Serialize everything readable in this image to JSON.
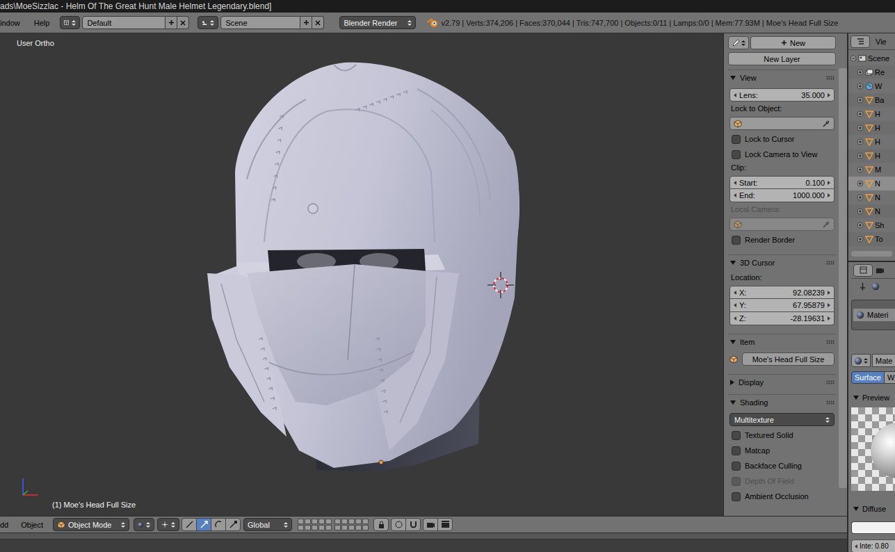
{
  "window": {
    "title": "ads\\MoeSizzlac - Helm Of The Great Hunt Male Helmet Legendary.blend]"
  },
  "info_header": {
    "menus": [
      "indow",
      "Help"
    ],
    "screen_layout": "Default",
    "scene": "Scene",
    "render_engine": "Blender Render",
    "stats": "v2.79 | Verts:374,206 | Faces:370,044 | Tris:747,700 | Objects:0/11 | Lamps:0/0 | Mem:77.93M | Moe's Head Full Size"
  },
  "viewport": {
    "view": "User Ortho",
    "active_object": "(1) Moe's Head Full Size"
  },
  "viewport_header": {
    "menus": [
      "dd",
      "Object"
    ],
    "mode": "Object Mode",
    "orientation": "Global"
  },
  "sidebar": {
    "grease_pencil": {
      "new": "New",
      "new_layer": "New Layer"
    },
    "panels": [
      {
        "title": "View",
        "expanded": true,
        "rows": [
          {
            "kind": "field",
            "label": "Lens:",
            "value": "35.000"
          },
          {
            "kind": "label",
            "text": "Lock to Object:",
            "disabled": false
          },
          {
            "kind": "picker",
            "disabled": false
          },
          {
            "kind": "checkbox",
            "text": "Lock to Cursor",
            "checked": false,
            "disabled": false
          },
          {
            "kind": "checkbox",
            "text": "Lock Camera to View",
            "checked": false,
            "disabled": false
          },
          {
            "kind": "label",
            "text": "Clip:",
            "disabled": false
          },
          {
            "kind": "column",
            "items": [
              {
                "label": "Start:",
                "value": "0.100"
              },
              {
                "label": "End:",
                "value": "1000.000"
              }
            ]
          },
          {
            "kind": "label",
            "text": "Local Camera:",
            "disabled": true
          },
          {
            "kind": "picker",
            "disabled": true
          },
          {
            "kind": "checkbox",
            "text": "Render Border",
            "checked": false,
            "disabled": false
          }
        ]
      },
      {
        "title": "3D Cursor",
        "expanded": true,
        "rows": [
          {
            "kind": "label",
            "text": "Location:",
            "disabled": false
          },
          {
            "kind": "column",
            "items": [
              {
                "label": "X:",
                "value": "92.08239"
              },
              {
                "label": "Y:",
                "value": "67.95879"
              },
              {
                "label": "Z:",
                "value": "-28.19631"
              }
            ]
          }
        ]
      },
      {
        "title": "Item",
        "expanded": true,
        "rows": [
          {
            "kind": "name",
            "value": "Moe's Head Full Size"
          }
        ]
      },
      {
        "title": "Display",
        "expanded": false,
        "rows": []
      },
      {
        "title": "Shading",
        "expanded": true,
        "rows": [
          {
            "kind": "dropdown",
            "value": "Multitexture"
          },
          {
            "kind": "checkbox",
            "text": "Textured Solid",
            "checked": false,
            "disabled": false
          },
          {
            "kind": "checkbox",
            "text": "Matcap",
            "checked": false,
            "disabled": false
          },
          {
            "kind": "checkbox",
            "text": "Backface Culling",
            "checked": false,
            "disabled": false
          },
          {
            "kind": "checkbox",
            "text": "Depth Of Field",
            "checked": false,
            "disabled": true
          },
          {
            "kind": "checkbox",
            "text": "Ambient Occlusion",
            "checked": false,
            "disabled": false
          }
        ]
      }
    ]
  },
  "outliner": {
    "menu": "Vie",
    "items": [
      {
        "kind": "scene",
        "label": "Scene",
        "expanded": true,
        "selected": false
      },
      {
        "kind": "render_layers",
        "label": "Re",
        "expanded": false,
        "selected": false
      },
      {
        "kind": "world",
        "label": "W",
        "expanded": false,
        "selected": false
      },
      {
        "kind": "object",
        "label": "Ba",
        "expanded": false,
        "selected": false
      },
      {
        "kind": "object",
        "label": "H",
        "expanded": false,
        "selected": false
      },
      {
        "kind": "object",
        "label": "H",
        "expanded": false,
        "selected": false
      },
      {
        "kind": "object",
        "label": "H",
        "expanded": false,
        "selected": false
      },
      {
        "kind": "object",
        "label": "H",
        "expanded": false,
        "selected": false
      },
      {
        "kind": "object",
        "label": "M",
        "expanded": false,
        "selected": false
      },
      {
        "kind": "object",
        "label": "N",
        "expanded": false,
        "selected": true
      },
      {
        "kind": "object",
        "label": "N",
        "expanded": false,
        "selected": false
      },
      {
        "kind": "object",
        "label": "N",
        "expanded": false,
        "selected": false
      },
      {
        "kind": "object",
        "label": "Sh",
        "expanded": false,
        "selected": false
      },
      {
        "kind": "object",
        "label": "To",
        "expanded": false,
        "selected": false
      }
    ]
  },
  "properties": {
    "material_slots": [
      {
        "label": "Materi",
        "selected": true
      }
    ],
    "material_name": "Mate",
    "tabs": [
      {
        "label": "Surface",
        "selected": true
      },
      {
        "label": "W",
        "selected": false
      }
    ],
    "panels": [
      {
        "title": "Preview",
        "expanded": true
      },
      {
        "title": "Diffuse",
        "expanded": true
      }
    ],
    "intensity": "Inte: 0.80"
  }
}
